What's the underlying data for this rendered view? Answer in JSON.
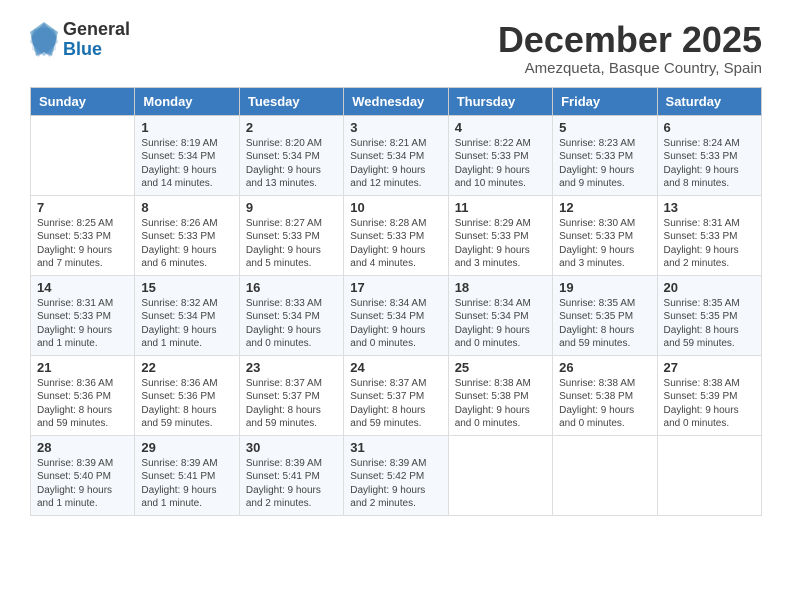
{
  "header": {
    "logo_general": "General",
    "logo_blue": "Blue",
    "month_title": "December 2025",
    "location": "Amezqueta, Basque Country, Spain"
  },
  "weekdays": [
    "Sunday",
    "Monday",
    "Tuesday",
    "Wednesday",
    "Thursday",
    "Friday",
    "Saturday"
  ],
  "weeks": [
    [
      {
        "day": "",
        "info": ""
      },
      {
        "day": "1",
        "info": "Sunrise: 8:19 AM\nSunset: 5:34 PM\nDaylight: 9 hours\nand 14 minutes."
      },
      {
        "day": "2",
        "info": "Sunrise: 8:20 AM\nSunset: 5:34 PM\nDaylight: 9 hours\nand 13 minutes."
      },
      {
        "day": "3",
        "info": "Sunrise: 8:21 AM\nSunset: 5:34 PM\nDaylight: 9 hours\nand 12 minutes."
      },
      {
        "day": "4",
        "info": "Sunrise: 8:22 AM\nSunset: 5:33 PM\nDaylight: 9 hours\nand 10 minutes."
      },
      {
        "day": "5",
        "info": "Sunrise: 8:23 AM\nSunset: 5:33 PM\nDaylight: 9 hours\nand 9 minutes."
      },
      {
        "day": "6",
        "info": "Sunrise: 8:24 AM\nSunset: 5:33 PM\nDaylight: 9 hours\nand 8 minutes."
      }
    ],
    [
      {
        "day": "7",
        "info": "Sunrise: 8:25 AM\nSunset: 5:33 PM\nDaylight: 9 hours\nand 7 minutes."
      },
      {
        "day": "8",
        "info": "Sunrise: 8:26 AM\nSunset: 5:33 PM\nDaylight: 9 hours\nand 6 minutes."
      },
      {
        "day": "9",
        "info": "Sunrise: 8:27 AM\nSunset: 5:33 PM\nDaylight: 9 hours\nand 5 minutes."
      },
      {
        "day": "10",
        "info": "Sunrise: 8:28 AM\nSunset: 5:33 PM\nDaylight: 9 hours\nand 4 minutes."
      },
      {
        "day": "11",
        "info": "Sunrise: 8:29 AM\nSunset: 5:33 PM\nDaylight: 9 hours\nand 3 minutes."
      },
      {
        "day": "12",
        "info": "Sunrise: 8:30 AM\nSunset: 5:33 PM\nDaylight: 9 hours\nand 3 minutes."
      },
      {
        "day": "13",
        "info": "Sunrise: 8:31 AM\nSunset: 5:33 PM\nDaylight: 9 hours\nand 2 minutes."
      }
    ],
    [
      {
        "day": "14",
        "info": "Sunrise: 8:31 AM\nSunset: 5:33 PM\nDaylight: 9 hours\nand 1 minute."
      },
      {
        "day": "15",
        "info": "Sunrise: 8:32 AM\nSunset: 5:34 PM\nDaylight: 9 hours\nand 1 minute."
      },
      {
        "day": "16",
        "info": "Sunrise: 8:33 AM\nSunset: 5:34 PM\nDaylight: 9 hours\nand 0 minutes."
      },
      {
        "day": "17",
        "info": "Sunrise: 8:34 AM\nSunset: 5:34 PM\nDaylight: 9 hours\nand 0 minutes."
      },
      {
        "day": "18",
        "info": "Sunrise: 8:34 AM\nSunset: 5:34 PM\nDaylight: 9 hours\nand 0 minutes."
      },
      {
        "day": "19",
        "info": "Sunrise: 8:35 AM\nSunset: 5:35 PM\nDaylight: 8 hours\nand 59 minutes."
      },
      {
        "day": "20",
        "info": "Sunrise: 8:35 AM\nSunset: 5:35 PM\nDaylight: 8 hours\nand 59 minutes."
      }
    ],
    [
      {
        "day": "21",
        "info": "Sunrise: 8:36 AM\nSunset: 5:36 PM\nDaylight: 8 hours\nand 59 minutes."
      },
      {
        "day": "22",
        "info": "Sunrise: 8:36 AM\nSunset: 5:36 PM\nDaylight: 8 hours\nand 59 minutes."
      },
      {
        "day": "23",
        "info": "Sunrise: 8:37 AM\nSunset: 5:37 PM\nDaylight: 8 hours\nand 59 minutes."
      },
      {
        "day": "24",
        "info": "Sunrise: 8:37 AM\nSunset: 5:37 PM\nDaylight: 8 hours\nand 59 minutes."
      },
      {
        "day": "25",
        "info": "Sunrise: 8:38 AM\nSunset: 5:38 PM\nDaylight: 9 hours\nand 0 minutes."
      },
      {
        "day": "26",
        "info": "Sunrise: 8:38 AM\nSunset: 5:38 PM\nDaylight: 9 hours\nand 0 minutes."
      },
      {
        "day": "27",
        "info": "Sunrise: 8:38 AM\nSunset: 5:39 PM\nDaylight: 9 hours\nand 0 minutes."
      }
    ],
    [
      {
        "day": "28",
        "info": "Sunrise: 8:39 AM\nSunset: 5:40 PM\nDaylight: 9 hours\nand 1 minute."
      },
      {
        "day": "29",
        "info": "Sunrise: 8:39 AM\nSunset: 5:41 PM\nDaylight: 9 hours\nand 1 minute."
      },
      {
        "day": "30",
        "info": "Sunrise: 8:39 AM\nSunset: 5:41 PM\nDaylight: 9 hours\nand 2 minutes."
      },
      {
        "day": "31",
        "info": "Sunrise: 8:39 AM\nSunset: 5:42 PM\nDaylight: 9 hours\nand 2 minutes."
      },
      {
        "day": "",
        "info": ""
      },
      {
        "day": "",
        "info": ""
      },
      {
        "day": "",
        "info": ""
      }
    ]
  ]
}
